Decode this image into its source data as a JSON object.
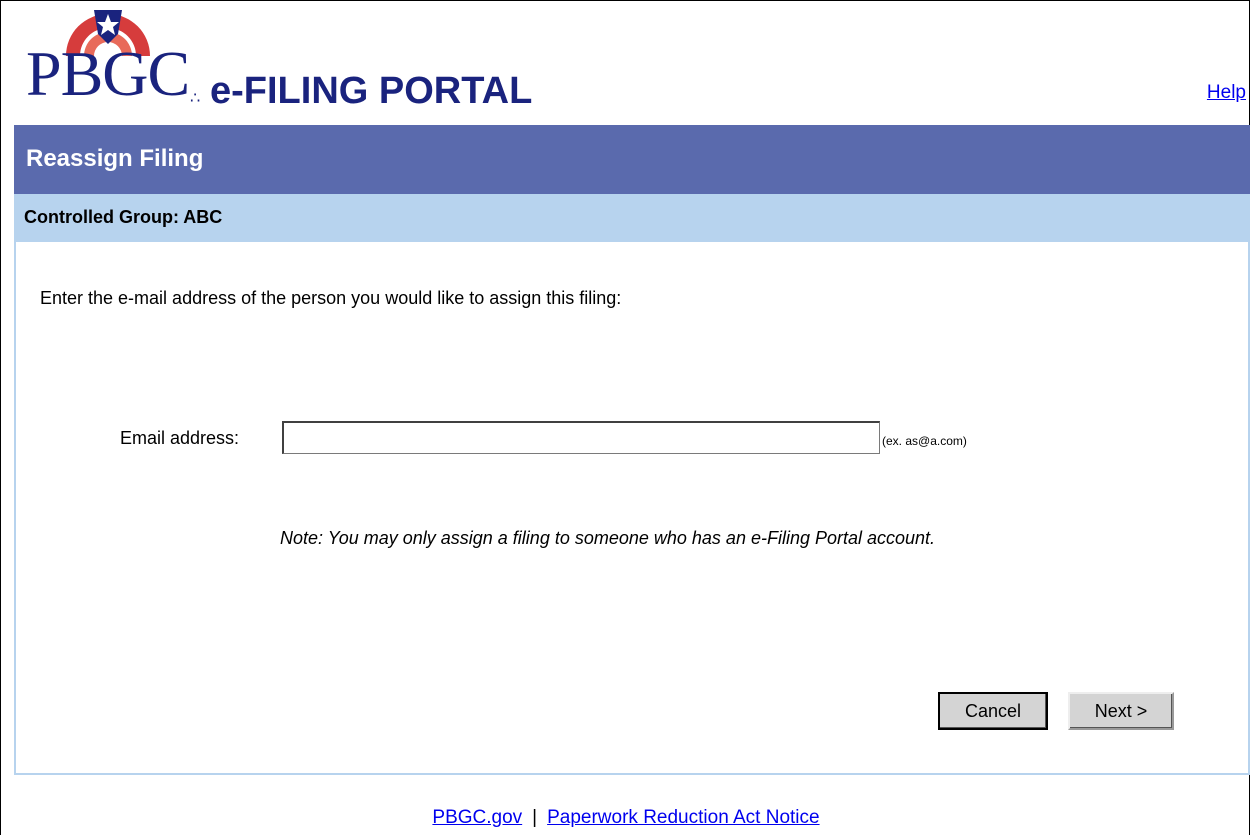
{
  "header": {
    "logo_main": "PBGC",
    "logo_sub": "e-FILING PORTAL",
    "help_link": "Help"
  },
  "page": {
    "title": "Reassign Filing",
    "controlled_group": "Controlled Group: ABC"
  },
  "form": {
    "intro": "Enter the e-mail address of the person you would like to assign this filing:",
    "email_label": "Email address:",
    "email_value": "",
    "email_hint": "(ex. as@a.com)",
    "note": "Note: You may only assign a filing to someone who has an e-Filing Portal account.",
    "cancel_label": "Cancel",
    "next_label": "Next >"
  },
  "footer": {
    "link1": "PBGC.gov",
    "separator": "|",
    "link2": "Paperwork Reduction Act Notice"
  },
  "colors": {
    "title_bar": "#5a6aad",
    "sub_bar": "#b7d3ee",
    "logo_blue": "#1a237e",
    "logo_red": "#d63c3c",
    "link": "#0000ee"
  }
}
